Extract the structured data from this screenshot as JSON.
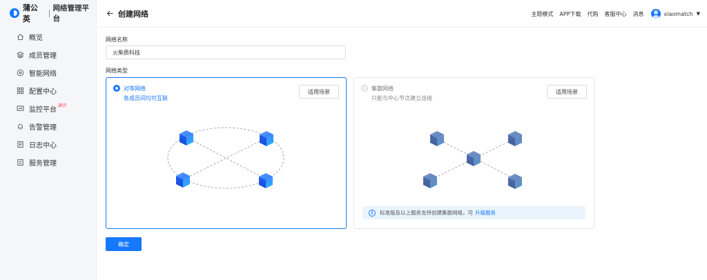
{
  "brand": {
    "name": "蒲公英",
    "subtitle": "网络管理平台"
  },
  "sidebar": {
    "items": [
      {
        "label": "概览",
        "icon": "home-icon"
      },
      {
        "label": "成员管理",
        "icon": "layers-icon"
      },
      {
        "label": "智能网络",
        "icon": "network-circle-icon"
      },
      {
        "label": "配置中心",
        "icon": "grid-icon"
      },
      {
        "label": "监控平台",
        "icon": "monitor-icon",
        "badge": "演示"
      },
      {
        "label": "告警管理",
        "icon": "bell-icon"
      },
      {
        "label": "日志中心",
        "icon": "log-icon"
      },
      {
        "label": "服务管理",
        "icon": "service-icon"
      }
    ]
  },
  "header": {
    "title": "创建网络",
    "links": [
      "主题模式",
      "APP下载",
      "代购",
      "客服中心",
      "消息"
    ],
    "username": "xiaomatch"
  },
  "form": {
    "name_label": "网络名称",
    "name_value": "火柴质科技",
    "type_label": "网络类型",
    "confirm_label": "确定"
  },
  "options": [
    {
      "title": "对等网络",
      "desc": "各成员间均可互联",
      "scene_button": "适用场景",
      "selected": true
    },
    {
      "title": "集散网络",
      "desc": "只能与中心节点建立连接",
      "scene_button": "适用场景",
      "selected": false
    }
  ],
  "notice": {
    "text": "标准版及以上服务支持创建集散网络，可",
    "link": "升级服务"
  },
  "colors": {
    "primary": "#1677ff",
    "badge": "#ff4d6a",
    "notice_bg": "#eaf4fd"
  }
}
